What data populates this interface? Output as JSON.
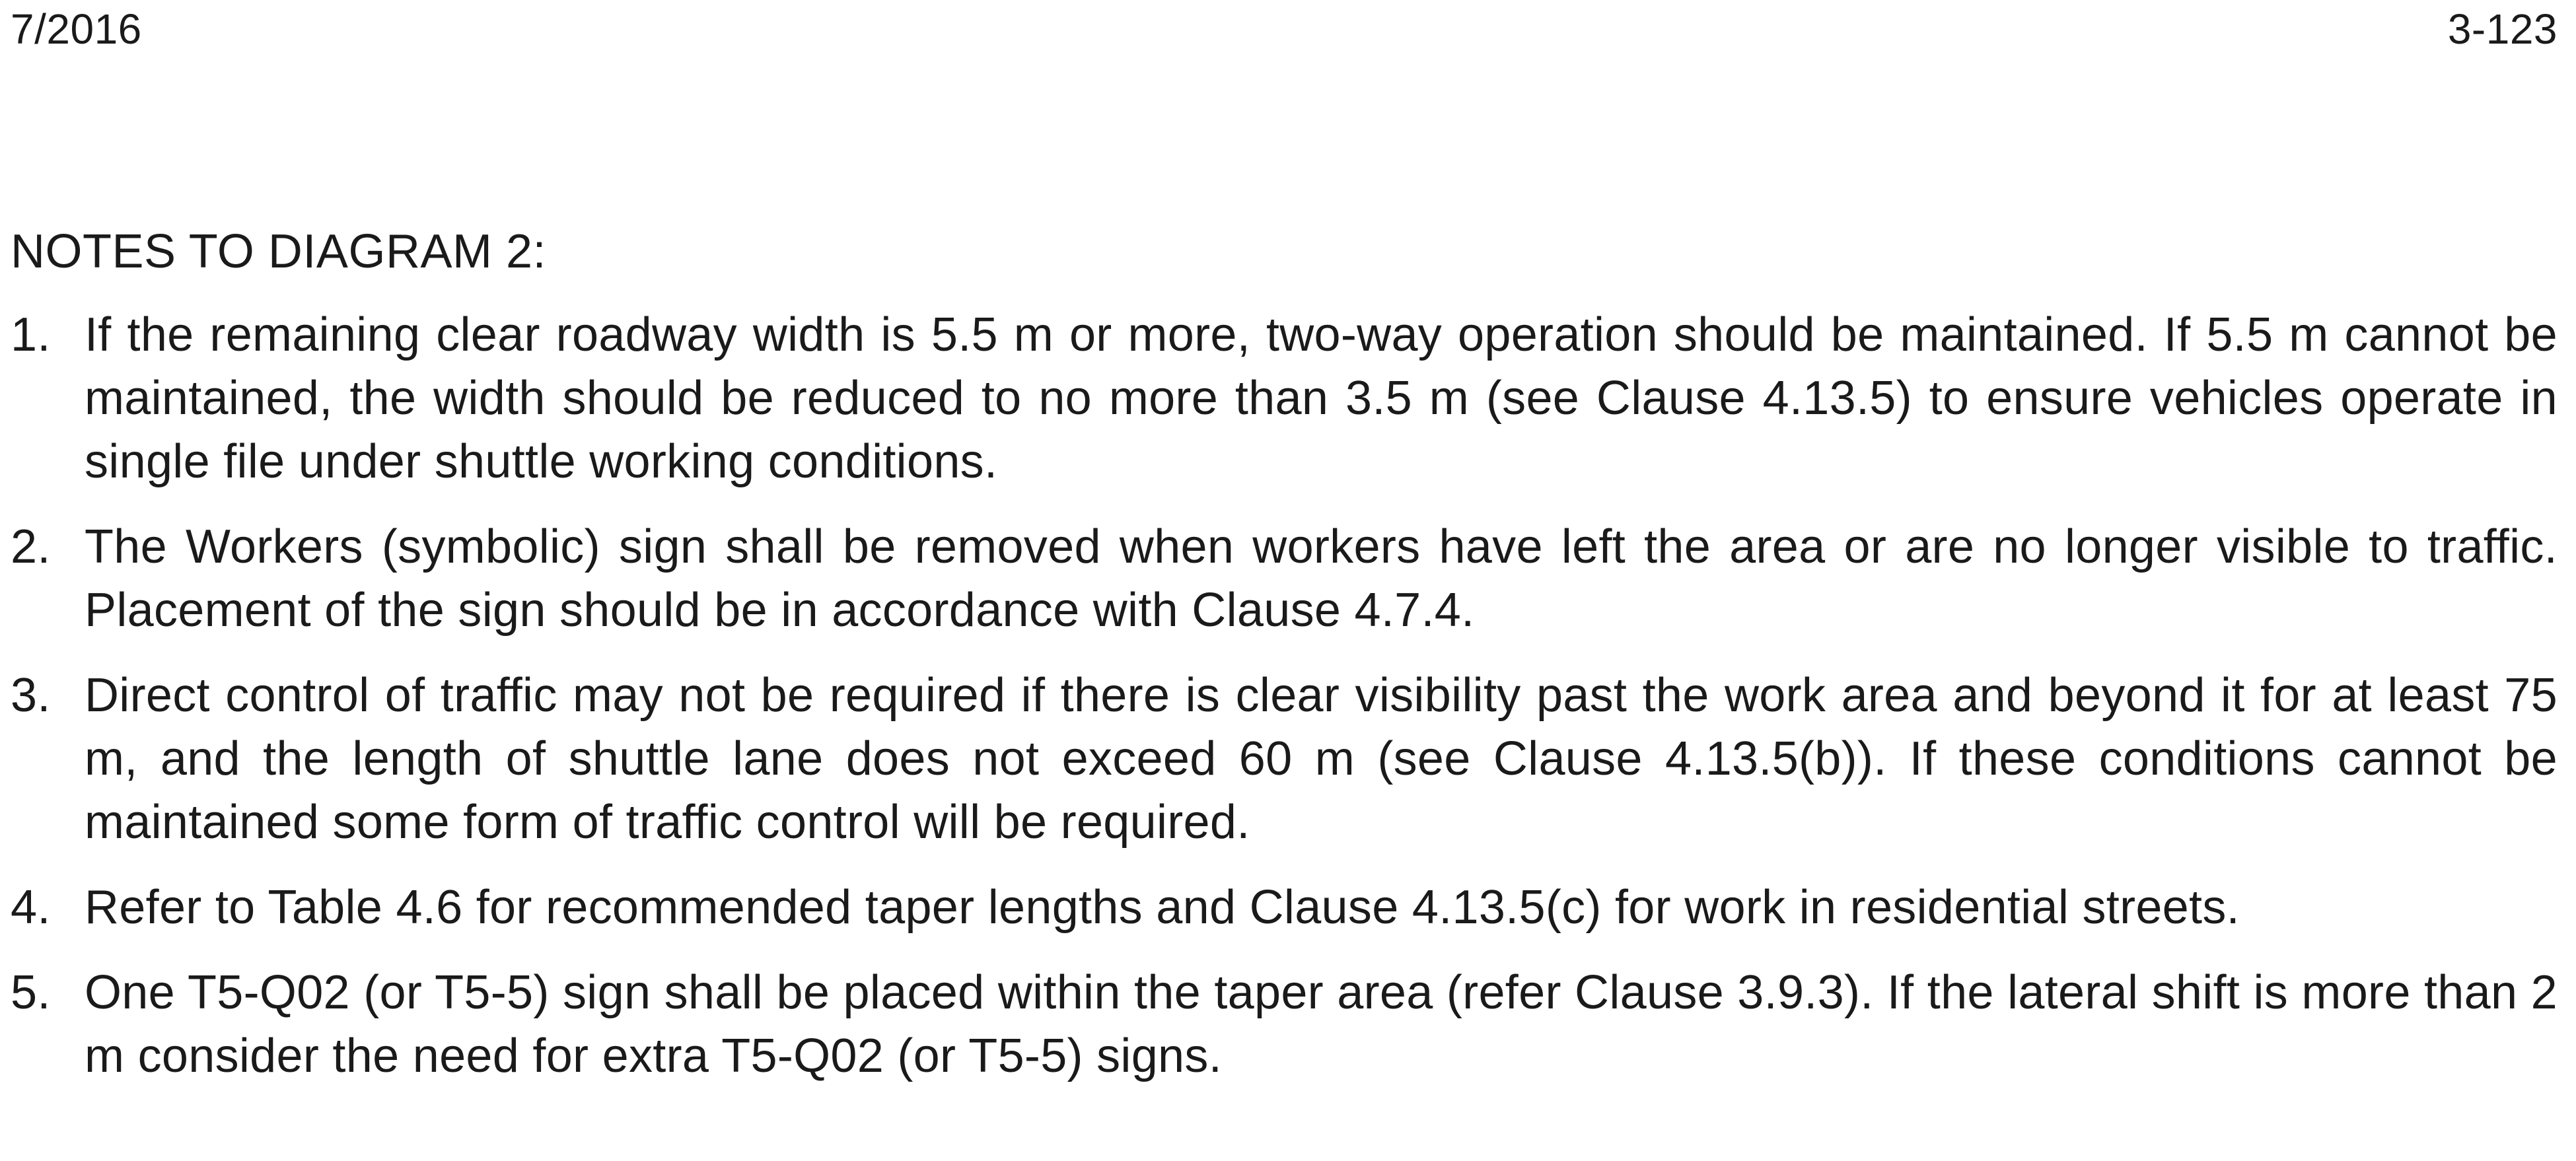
{
  "header": {
    "date": "7/2016",
    "page_number": "3-123"
  },
  "notes": {
    "title": "NOTES TO DIAGRAM 2:",
    "items": [
      {
        "number": "1.",
        "text": "If the remaining clear roadway width is 5.5 m or more, two-way operation should be maintained. If 5.5 m cannot be maintained, the width should be reduced to no more than 3.5 m (see Clause 4.13.5) to ensure vehicles operate in single file under shuttle working conditions."
      },
      {
        "number": "2.",
        "text": "The Workers (symbolic) sign shall be removed when workers have left the area or are no longer visible to traffic. Placement of the sign should be in accordance with Clause 4.7.4."
      },
      {
        "number": "3.",
        "text": "Direct control of traffic may not be required if there is clear visibility past the work area  and beyond it for at least 75 m, and the length of shuttle lane does not exceed 60 m (see Clause 4.13.5(b)). If these conditions cannot be maintained some form of traffic control will be required."
      },
      {
        "number": "4.",
        "text": "Refer to Table 4.6 for recommended taper lengths and Clause 4.13.5(c) for work in residential streets."
      },
      {
        "number": "5.",
        "text": "One T5-Q02 (or T5-5) sign shall be placed within the taper area (refer Clause 3.9.3). If the lateral shift is more than 2 m consider the need for extra T5-Q02 (or T5-5) signs."
      }
    ]
  }
}
